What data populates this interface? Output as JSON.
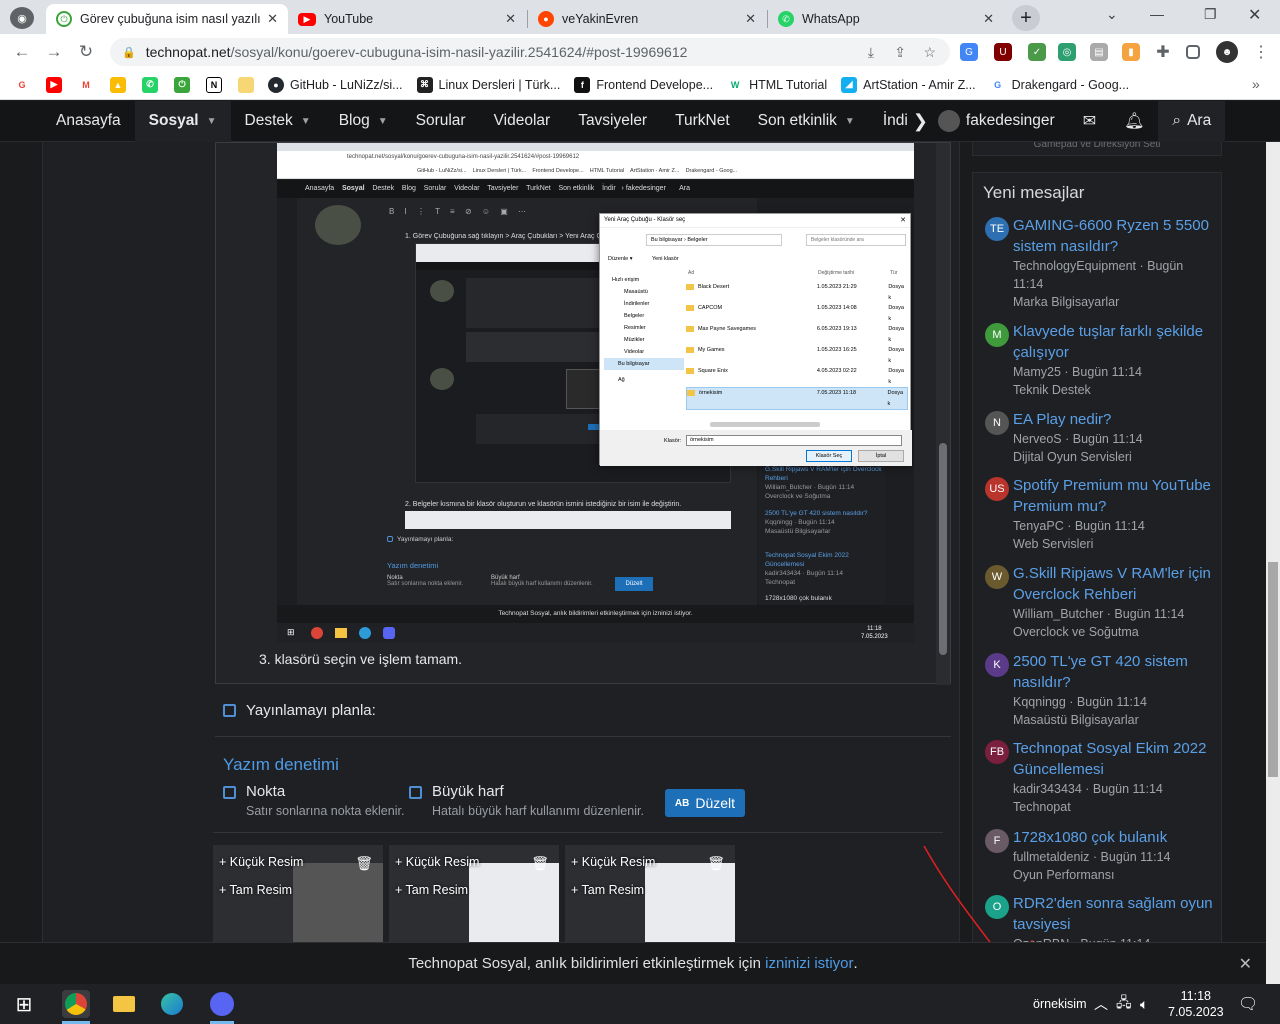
{
  "browser": {
    "tabs": [
      {
        "title": "Görev çubuğuna isim nasıl yazılır",
        "active": true,
        "icon": "technopat-icon"
      },
      {
        "title": "YouTube",
        "active": false,
        "icon": "youtube-icon"
      },
      {
        "title": "veYakinEvren",
        "active": false,
        "icon": "reddit-icon"
      },
      {
        "title": "WhatsApp",
        "active": false,
        "icon": "whatsapp-icon"
      }
    ],
    "new_tab": "+",
    "url_host": "technopat.net",
    "url_path": "/sosyal/konu/goerev-cubuguna-isim-nasil-yazilir.2541624/#post-19969612",
    "bookmarks": [
      {
        "label": "GitHub - LuNiZz/si...",
        "icon": "github-icon"
      },
      {
        "label": "Linux Dersleri | Türk...",
        "icon": "linux-icon"
      },
      {
        "label": "Frontend Develope...",
        "icon": "frontend-icon"
      },
      {
        "label": "HTML Tutorial",
        "icon": "w3schools-icon"
      },
      {
        "label": "ArtStation - Amir Z...",
        "icon": "artstation-icon"
      },
      {
        "label": "Drakengard - Goog...",
        "icon": "google-icon"
      }
    ],
    "more_bookmarks": "»"
  },
  "site_nav": {
    "items": [
      "Anasayfa",
      "Sosyal",
      "Destek",
      "Blog",
      "Sorular",
      "Videolar",
      "Tavsiyeler",
      "TurkNet",
      "Son etkinlik",
      "İndir"
    ],
    "user": "fakedesinger",
    "search": "Ara"
  },
  "post": {
    "step2": "2. Belgeler kısmına bir klasör oluşturun ve klasörün ismini istediğiniz bir isim ile değiştirin.",
    "step1": "1. Görev Çubuğuna sağ tıklayın > Araç Çubukları > Yeni Araç Çubuğu",
    "step3": "3. klasörü seçin ve işlem tamam.",
    "schedule": "Yayınlamayı planla:",
    "spellcheck_title": "Yazım denetimi",
    "opt1_label": "Nokta",
    "opt1_desc": "Satır sonlarına nokta eklenir.",
    "opt2_label": "Büyük harf",
    "opt2_desc": "Hatalı büyük harf kullanımı düzenlenir.",
    "fix_button": "Düzelt",
    "fix_icon": "AB",
    "thumbs": [
      {
        "small": "+ Küçük Resim",
        "full": "+ Tam Resim"
      },
      {
        "small": "+ Küçük Resim",
        "full": "+ Tam Resim"
      },
      {
        "small": "+ Küçük Resim",
        "full": "+ Tam Resim"
      }
    ]
  },
  "dialog": {
    "title": "Yeni Araç Çubuğu - Klasör seç",
    "path": "Bu bilgisayar  ›  Belgeler",
    "search_placeholder": "Belgeler klasöründe ara",
    "organize": "Düzenle ▾",
    "new_folder": "Yeni klasör",
    "nav": [
      "Hızlı erişim",
      "Masaüstü",
      "İndirilenler",
      "Belgeler",
      "Resimler",
      "Müzikler",
      "Videolar",
      "Bu bilgisayar",
      "Ağ"
    ],
    "col_name": "Ad",
    "col_date": "Değiştirme tarihi",
    "col_type": "Tür",
    "files": [
      {
        "name": "Black Desert",
        "date": "1.05.2023 21:29",
        "type": "Dosya k"
      },
      {
        "name": "CAPCOM",
        "date": "1.05.2023 14:08",
        "type": "Dosya k"
      },
      {
        "name": "Max Payne Savegames",
        "date": "6.05.2023 19:13",
        "type": "Dosya k"
      },
      {
        "name": "My Games",
        "date": "1.05.2023 16:25",
        "type": "Dosya k"
      },
      {
        "name": "Square Enix",
        "date": "4.05.2023 02:22",
        "type": "Dosya k"
      },
      {
        "name": "örnekisim",
        "date": "7.05.2023 11:18",
        "type": "Dosya k"
      }
    ],
    "folder_label": "Klasör:",
    "folder_value": "örnekisim",
    "select_btn": "Klasör Seç",
    "cancel_btn": "İptal"
  },
  "inner_shot": {
    "url": "technopat.net/sosyal/konu/goerev-cubuguna-isim-nasil-yazilir.2541624/#post-19969612",
    "nav": [
      "Anasayfa",
      "Sosyal",
      "Destek",
      "Blog",
      "Sorular",
      "Videolar",
      "Tavsiyeler",
      "TurkNet",
      "Son etkinlik",
      "İndir"
    ],
    "user": "fakedesinger",
    "search": "Ara",
    "schedule": "Yayınlamayı planla:",
    "spell": "Yazım denetimi",
    "opt1": "Nokta",
    "opt1_desc": "Satır sonlarına nokta eklenir.",
    "opt2": "Büyük harf",
    "opt2_desc": "Hatalı büyük harf kullanımı düzenlenir.",
    "fix": "Düzelt",
    "notify": "Technopat Sosyal, anlık bildirimleri etkinleştirmek için izninizi istiyor.",
    "notify_link": "izninizi istiyor.",
    "side": [
      {
        "t": "G.Skill Ripjaws V RAM'ler için Overclock Rehberi",
        "m": "William_Butcher · Bugün 11:14",
        "f": "Overclock ve Soğutma"
      },
      {
        "t": "2500 TL'ye GT 420 sistem nasıldır?",
        "m": "Kqqningg · Bugün 11:14",
        "f": "Masaüstü Bilgisayarlar"
      },
      {
        "t": "Technopat Sosyal Ekim 2022 Güncellemesi",
        "m": "kadir343434 · Bugün 11:14",
        "f": "Technopat"
      },
      {
        "t": "1728x1080 çok bulanık",
        "m": "",
        "f": ""
      }
    ],
    "clock_time": "11:18",
    "clock_date": "7.05.2023"
  },
  "sidebar": {
    "partial_top": "Gamepad ve Direksiyon Seti",
    "title": "Yeni mesajlar",
    "messages": [
      {
        "title": "GAMING-6600 Ryzen 5 5500 sistem nasıldır?",
        "meta": "TechnologyEquipment · Bugün 11:14",
        "forum": "Marka Bilgisayarlar",
        "avatar": "TE",
        "color": "#2d6fb0"
      },
      {
        "title": "Klavyede tuşlar farklı şekilde çalışıyor",
        "meta": "Mamy25 · Bugün 11:14",
        "forum": "Teknik Destek",
        "avatar": "M",
        "color": "#3e9a3b"
      },
      {
        "title": "EA Play nedir?",
        "meta": "NerveoS · Bugün 11:14",
        "forum": "Dijital Oyun Servisleri",
        "avatar": "N",
        "color": "#555"
      },
      {
        "title": "Spotify Premium mu YouTube Premium mu?",
        "meta": "TenyaPC · Bugün 11:14",
        "forum": "Web Servisleri",
        "avatar": "US",
        "color": "#b8342c"
      },
      {
        "title": "G.Skill Ripjaws V RAM'ler için Overclock Rehberi",
        "meta": "William_Butcher · Bugün 11:14",
        "forum": "Overclock ve Soğutma",
        "avatar": "W",
        "color": "#6b5a2e"
      },
      {
        "title": "2500 TL'ye GT 420 sistem nasıldır?",
        "meta": "Kqqningg · Bugün 11:14",
        "forum": "Masaüstü Bilgisayarlar",
        "avatar": "K",
        "color": "#5b3a8a"
      },
      {
        "title": "Technopat Sosyal Ekim 2022 Güncellemesi",
        "meta": "kadir343434 · Bugün 11:14",
        "forum": "Technopat",
        "avatar": "FB",
        "color": "#7a1f3d"
      },
      {
        "title": "1728x1080 çok bulanık",
        "meta": "fullmetaldeniz · Bugün 11:14",
        "forum": "Oyun Performansı",
        "avatar": "F",
        "color": "#6a5a66"
      },
      {
        "title": "RDR2'den sonra sağlam oyun tavsiyesi",
        "meta": "OzanRBN · Bugün 11:14",
        "forum": "",
        "avatar": "O",
        "color": "#1aa38a"
      }
    ]
  },
  "notification": {
    "text": "Technopat Sosyal, anlık bildirimleri etkinleştirmek için ",
    "link": "izninizi istiyor",
    "end": ".",
    "close": "✕"
  },
  "taskbar": {
    "toolbar_label": "örnekisim",
    "time": "11:18",
    "date": "7.05.2023"
  }
}
